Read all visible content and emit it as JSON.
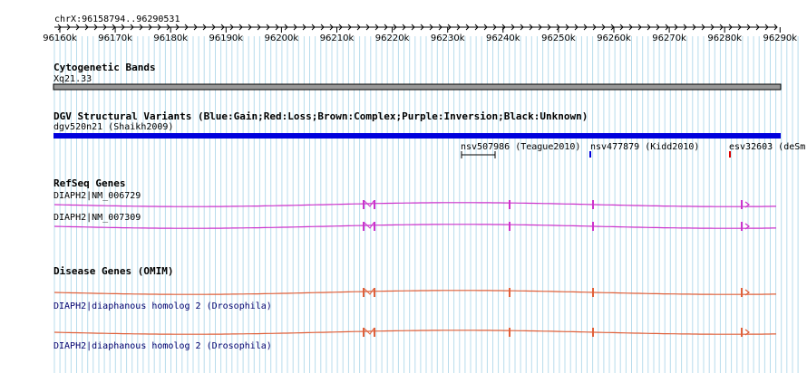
{
  "ruler": {
    "range_label": "chrX:96158794..96290531",
    "ticks": [
      "96160k",
      "96170k",
      "96180k",
      "96190k",
      "96200k",
      "96210k",
      "96220k",
      "96230k",
      "96240k",
      "96250k",
      "96260k",
      "96270k",
      "96280k",
      "96290k"
    ]
  },
  "tracks": {
    "cytoband": {
      "title": "Cytogenetic Bands",
      "band_label": "Xq21.33"
    },
    "dgv": {
      "title": "DGV Structural Variants (Blue:Gain;Red:Loss;Brown:Complex;Purple:Inversion;Black:Unknown)",
      "items": [
        {
          "label": "dgv520n21 (Shaikh2009)",
          "color": "#0000dd"
        },
        {
          "label": "nsv507986 (Teague2010)",
          "color": "#000000"
        },
        {
          "label": "nsv477879 (Kidd2010)",
          "color": "#0000dd"
        },
        {
          "label": "esv32603 (deSm",
          "color": "#dd0000"
        }
      ]
    },
    "refseq": {
      "title": "RefSeq Genes",
      "color": "#cc33cc",
      "genes": [
        {
          "label": "DIAPH2|NM_006729"
        },
        {
          "label": "DIAPH2|NM_007309"
        }
      ]
    },
    "omim": {
      "title": "Disease Genes (OMIM)",
      "color": "#e0603a",
      "genes": [
        {
          "label": "DIAPH2|diaphanous homolog 2 (Drosophila)"
        },
        {
          "label": "DIAPH2|diaphanous homolog 2 (Drosophila)"
        }
      ]
    }
  },
  "colors": {
    "grid": "#b8dcec",
    "cytoband_fill": "#999999",
    "variant_blue": "#0000dd",
    "text_blue": "#00006e"
  }
}
